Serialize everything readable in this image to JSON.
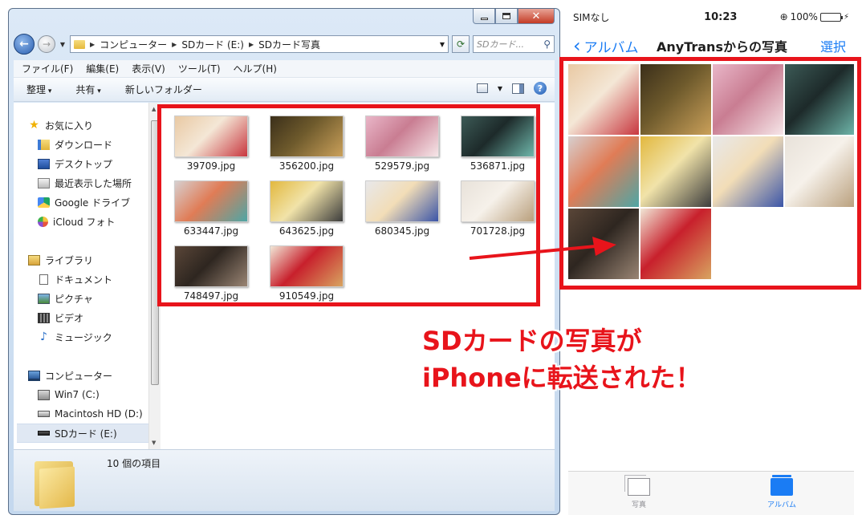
{
  "explorer": {
    "breadcrumb": [
      "コンピューター",
      "SDカード (E:)",
      "SDカード写真"
    ],
    "search_placeholder": "SDカード...",
    "menu": [
      "ファイル(F)",
      "編集(E)",
      "表示(V)",
      "ツール(T)",
      "ヘルプ(H)"
    ],
    "commands": {
      "organize": "整理",
      "share": "共有",
      "new_folder": "新しいフォルダー"
    },
    "nav": {
      "favorites": "お気に入り",
      "favorites_items": [
        "ダウンロード",
        "デスクトップ",
        "最近表示した場所",
        "Google ドライブ",
        "iCloud フォト"
      ],
      "libraries": "ライブラリ",
      "library_items": [
        "ドキュメント",
        "ピクチャ",
        "ビデオ",
        "ミュージック"
      ],
      "computer": "コンピューター",
      "computer_items": [
        "Win7 (C:)",
        "Macintosh HD (D:)",
        "SDカード (E:)"
      ]
    },
    "files": [
      {
        "name": "39709.jpg",
        "colors": [
          "#e9c9a3",
          "#c8373f",
          "#f4e7d6"
        ]
      },
      {
        "name": "356200.jpg",
        "colors": [
          "#3b2f1a",
          "#caa05a",
          "#6e5a2c"
        ]
      },
      {
        "name": "529579.jpg",
        "colors": [
          "#e9b6c8",
          "#f6e6e8",
          "#c97d92"
        ]
      },
      {
        "name": "536871.jpg",
        "colors": [
          "#3c5a56",
          "#6fb7ab",
          "#1d2a2a"
        ]
      },
      {
        "name": "633447.jpg",
        "colors": [
          "#d7cfcf",
          "#4ea6a5",
          "#e07c56"
        ]
      },
      {
        "name": "643625.jpg",
        "colors": [
          "#e2b83f",
          "#3c3c3c",
          "#f1e3a9"
        ]
      },
      {
        "name": "680345.jpg",
        "colors": [
          "#e8e8ea",
          "#3b55a8",
          "#f2ddb7"
        ]
      },
      {
        "name": "701728.jpg",
        "colors": [
          "#e8e2da",
          "#b99f7c",
          "#f6f1ea"
        ]
      },
      {
        "name": "748497.jpg",
        "colors": [
          "#5a4638",
          "#9a8574",
          "#2e2620"
        ]
      },
      {
        "name": "910549.jpg",
        "colors": [
          "#f1e6d6",
          "#d8a460",
          "#c8202c"
        ]
      }
    ],
    "status": "10 個の項目"
  },
  "phone": {
    "carrier": "SIMなし",
    "time": "10:23",
    "battery": "100%",
    "back_label": "アルバム",
    "title": "AnyTransからの写真",
    "select_label": "選択",
    "tabs": [
      "写真",
      "アルバム"
    ],
    "photo_colors": [
      [
        "#e9c9a3",
        "#c8373f",
        "#f4e7d6"
      ],
      [
        "#3b2f1a",
        "#caa05a",
        "#6e5a2c"
      ],
      [
        "#e9b6c8",
        "#f6e6e8",
        "#c97d92"
      ],
      [
        "#3c5a56",
        "#6fb7ab",
        "#1d2a2a"
      ],
      [
        "#d7cfcf",
        "#4ea6a5",
        "#e07c56"
      ],
      [
        "#e2b83f",
        "#3c3c3c",
        "#f1e3a9"
      ],
      [
        "#e8e8ea",
        "#3b55a8",
        "#f2ddb7"
      ],
      [
        "#e8e2da",
        "#b99f7c",
        "#f6f1ea"
      ],
      [
        "#5a4638",
        "#9a8574",
        "#2e2620"
      ],
      [
        "#f1e6d6",
        "#d8a460",
        "#c8202c"
      ]
    ]
  },
  "annotation": {
    "line1": "SDカードの写真が",
    "line2": "iPhoneに転送された！"
  },
  "colors": {
    "highlight": "#e8141b",
    "ios_blue": "#1a7cf4"
  }
}
